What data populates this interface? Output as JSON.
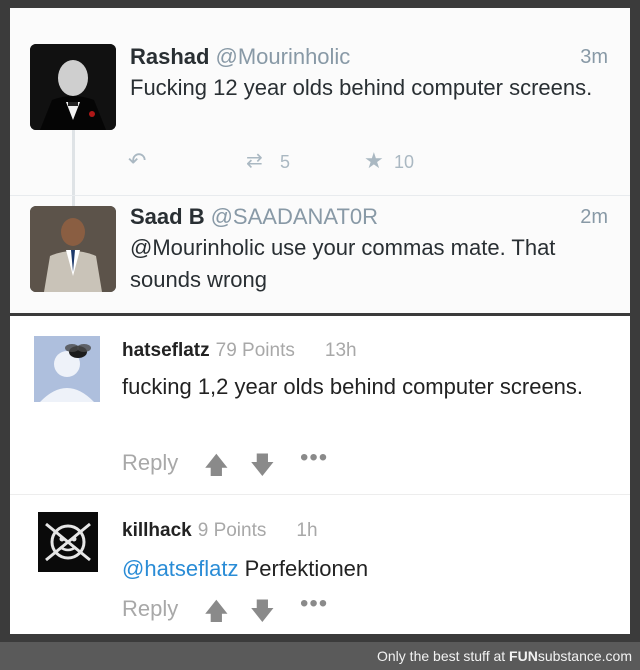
{
  "tweets": [
    {
      "name": "Rashad",
      "handle": "@Mourinholic",
      "time": "3m",
      "text": "Fucking 12 year olds behind computer screens.",
      "retweets": "5",
      "favorites": "10"
    },
    {
      "name": "Saad B",
      "handle": "@SAADANAT0R",
      "time": "2m",
      "text": "@Mourinholic use your commas mate. That sounds wrong"
    }
  ],
  "comments": [
    {
      "user": "hatseflatz",
      "points": "79 Points",
      "time": "13h",
      "text": "fucking 1,2 year olds behind computer screens.",
      "reply": "Reply",
      "more": "•••"
    },
    {
      "user": "killhack",
      "points": "9 Points",
      "time": "1h",
      "mention": "@hatseflatz",
      "text": "Perfektionen",
      "reply": "Reply",
      "more": "•••"
    }
  ],
  "footer": {
    "prefix": "Only the best stuff at",
    "brand_bold": "FUN",
    "brand_rest": "substance",
    "suffix": ".com"
  }
}
